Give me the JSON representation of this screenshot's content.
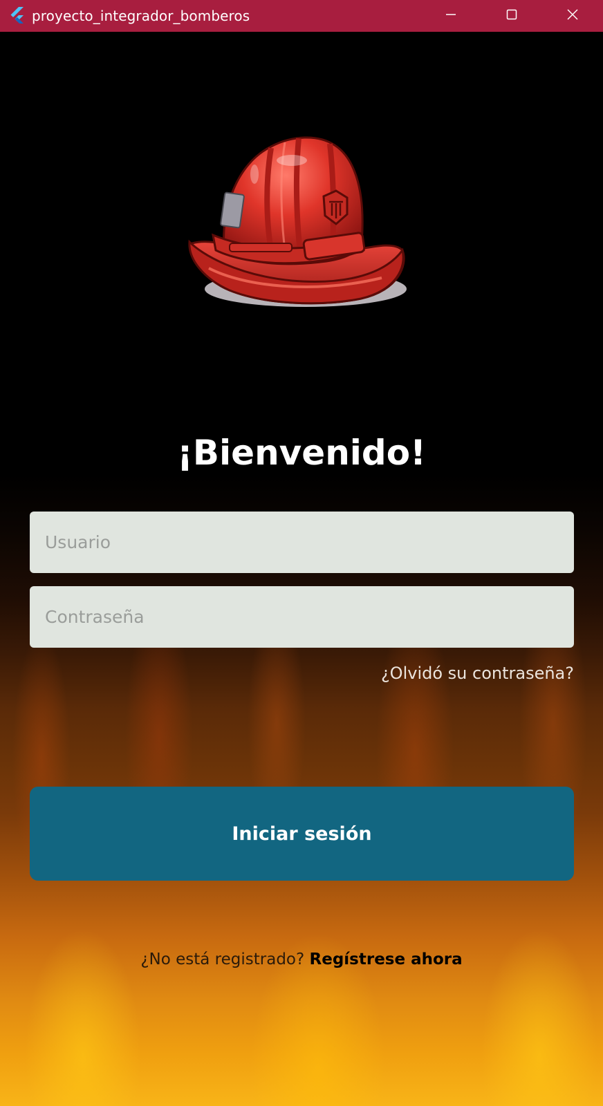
{
  "window": {
    "title": "proyecto_integrador_bomberos",
    "app_icon": "flutter-icon",
    "controls": [
      "minimize-icon",
      "maximize-icon",
      "close-icon"
    ]
  },
  "logo": {
    "icon": "firefighter-helmet-icon"
  },
  "login": {
    "heading": "¡Bienvenido!",
    "username_placeholder": "Usuario",
    "username_value": "",
    "password_placeholder": "Contraseña",
    "password_value": "",
    "forgot_password": "¿Olvidó su contraseña?",
    "submit_label": "Iniciar sesión"
  },
  "register": {
    "prompt": "¿No está registrado?",
    "link": "Regístrese ahora"
  },
  "colors": {
    "titlebar": "#a81e3f",
    "button": "#126681",
    "field": "#e0e5df"
  }
}
